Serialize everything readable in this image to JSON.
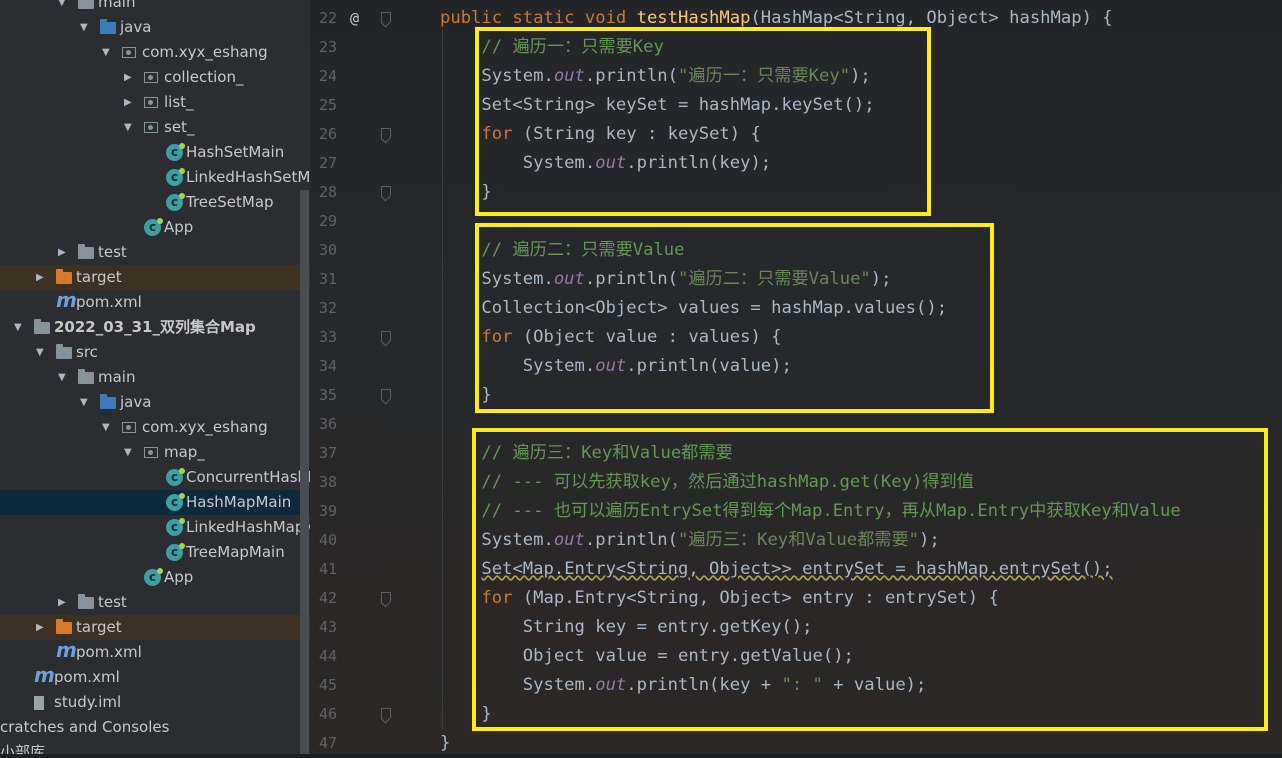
{
  "project_tree": {
    "items": [
      {
        "label": "main",
        "indent": 2,
        "arrow": "down",
        "icon": "folder"
      },
      {
        "label": "java",
        "indent": 3,
        "arrow": "down",
        "icon": "folder-blue"
      },
      {
        "label": "com.xyx_eshang",
        "indent": 4,
        "arrow": "down",
        "icon": "package"
      },
      {
        "label": "collection_",
        "indent": 5,
        "arrow": "right",
        "icon": "package"
      },
      {
        "label": "list_",
        "indent": 5,
        "arrow": "right",
        "icon": "package"
      },
      {
        "label": "set_",
        "indent": 5,
        "arrow": "down",
        "icon": "package"
      },
      {
        "label": "HashSetMain",
        "indent": 6,
        "icon": "class"
      },
      {
        "label": "LinkedHashSetMain",
        "indent": 6,
        "icon": "class"
      },
      {
        "label": "TreeSetMap",
        "indent": 6,
        "icon": "class"
      },
      {
        "label": "App",
        "indent": 5,
        "icon": "class"
      },
      {
        "label": "test",
        "indent": 2,
        "arrow": "right",
        "icon": "folder"
      },
      {
        "label": "target",
        "indent": 1,
        "arrow": "right",
        "icon": "folder-orange",
        "highlight": "excluded"
      },
      {
        "label": "pom.xml",
        "indent": 1,
        "icon": "maven"
      },
      {
        "label": "2022_03_31_双列集合Map",
        "indent": 0,
        "arrow": "down",
        "icon": "folder",
        "bold": true
      },
      {
        "label": "src",
        "indent": 1,
        "arrow": "down",
        "icon": "folder"
      },
      {
        "label": "main",
        "indent": 2,
        "arrow": "down",
        "icon": "folder"
      },
      {
        "label": "java",
        "indent": 3,
        "arrow": "down",
        "icon": "folder-blue"
      },
      {
        "label": "com.xyx_eshang",
        "indent": 4,
        "arrow": "down",
        "icon": "package"
      },
      {
        "label": "map_",
        "indent": 5,
        "arrow": "down",
        "icon": "package"
      },
      {
        "label": "ConcurrentHashMapM",
        "indent": 6,
        "icon": "class"
      },
      {
        "label": "HashMapMain",
        "indent": 6,
        "icon": "class",
        "highlight": "selected"
      },
      {
        "label": "LinkedHashMapMain",
        "indent": 6,
        "icon": "class"
      },
      {
        "label": "TreeMapMain",
        "indent": 6,
        "icon": "class"
      },
      {
        "label": "App",
        "indent": 5,
        "icon": "class"
      },
      {
        "label": "test",
        "indent": 2,
        "arrow": "right",
        "icon": "folder"
      },
      {
        "label": "target",
        "indent": 1,
        "arrow": "right",
        "icon": "folder-orange",
        "highlight": "excluded"
      },
      {
        "label": "pom.xml",
        "indent": 1,
        "icon": "maven"
      },
      {
        "label": "pom.xml",
        "indent": 0,
        "icon": "maven"
      },
      {
        "label": "study.iml",
        "indent": 0,
        "icon": "iml"
      },
      {
        "label": "cratches and Consoles",
        "indent": -1,
        "icon": "none"
      },
      {
        "label": "小部库",
        "indent": -1,
        "icon": "none"
      }
    ]
  },
  "editor": {
    "line_numbers": [
      "22",
      "23",
      "24",
      "25",
      "26",
      "27",
      "28",
      "29",
      "30",
      "31",
      "32",
      "33",
      "34",
      "35",
      "36",
      "37",
      "38",
      "39",
      "40",
      "41",
      "42",
      "43",
      "44",
      "45",
      "46",
      "47"
    ],
    "override_marker": "@",
    "lines": [
      [
        [
          "kw",
          "public static void "
        ],
        [
          "fn",
          "testHashMap"
        ],
        [
          "ty",
          "(HashMap<String, Object> hashMap) {"
        ]
      ],
      [
        [
          "ty",
          "    "
        ],
        [
          "cm",
          "// 遍历一：只需要Key"
        ]
      ],
      [
        [
          "ty",
          "    System."
        ],
        [
          "it",
          "out"
        ],
        [
          "ty",
          ".println("
        ],
        [
          "st",
          "\"遍历一：只需要Key\""
        ],
        [
          "ty",
          ");"
        ]
      ],
      [
        [
          "ty",
          "    Set<String> keySet = hashMap.keySet();"
        ]
      ],
      [
        [
          "ty",
          "    "
        ],
        [
          "kw",
          "for "
        ],
        [
          "ty",
          "(String key : keySet) {"
        ]
      ],
      [
        [
          "ty",
          "        System."
        ],
        [
          "it",
          "out"
        ],
        [
          "ty",
          ".println(key);"
        ]
      ],
      [
        [
          "ty",
          "    }"
        ]
      ],
      [
        [
          "ty",
          ""
        ]
      ],
      [
        [
          "ty",
          "    "
        ],
        [
          "cm",
          "// 遍历二：只需要Value"
        ]
      ],
      [
        [
          "ty",
          "    System."
        ],
        [
          "it",
          "out"
        ],
        [
          "ty",
          ".println("
        ],
        [
          "st",
          "\"遍历二：只需要Value\""
        ],
        [
          "ty",
          ");"
        ]
      ],
      [
        [
          "ty",
          "    Collection<Object> values = hashMap.values();"
        ]
      ],
      [
        [
          "ty",
          "    "
        ],
        [
          "kw",
          "for "
        ],
        [
          "ty",
          "(Object value : values) {"
        ]
      ],
      [
        [
          "ty",
          "        System."
        ],
        [
          "it",
          "out"
        ],
        [
          "ty",
          ".println(value);"
        ]
      ],
      [
        [
          "ty",
          "    }"
        ]
      ],
      [
        [
          "ty",
          ""
        ]
      ],
      [
        [
          "ty",
          "    "
        ],
        [
          "cm",
          "// 遍历三：Key和Value都需要"
        ]
      ],
      [
        [
          "ty",
          "    "
        ],
        [
          "cm",
          "// --- 可以先获取key，然后通过hashMap.get(Key)得到值"
        ]
      ],
      [
        [
          "ty",
          "    "
        ],
        [
          "cm",
          "// --- 也可以遍历EntrySet得到每个Map.Entry，再从Map.Entry中获取Key和Value"
        ]
      ],
      [
        [
          "ty",
          "    System."
        ],
        [
          "it",
          "out"
        ],
        [
          "ty",
          ".println("
        ],
        [
          "st",
          "\"遍历三：Key和Value都需要\""
        ],
        [
          "ty",
          ");"
        ]
      ],
      [
        [
          "ty",
          "    "
        ],
        [
          "wave",
          "Set<Map.Entry<String, Object>> entrySet = hashMap.entrySet();"
        ]
      ],
      [
        [
          "ty",
          "    "
        ],
        [
          "kw",
          "for "
        ],
        [
          "ty",
          "(Map.Entry<String, Object> entry : entrySet) {"
        ]
      ],
      [
        [
          "ty",
          "        String key = entry.getKey();"
        ]
      ],
      [
        [
          "ty",
          "        Object value = entry.getValue();"
        ]
      ],
      [
        [
          "ty",
          "        System."
        ],
        [
          "it",
          "out"
        ],
        [
          "ty",
          ".println(key + "
        ],
        [
          "st",
          "\": \""
        ],
        [
          "ty",
          " + value);"
        ]
      ],
      [
        [
          "ty",
          "    }"
        ]
      ],
      [
        [
          "ty",
          "}"
        ]
      ]
    ],
    "highlight_color": "#ffeb1a"
  }
}
